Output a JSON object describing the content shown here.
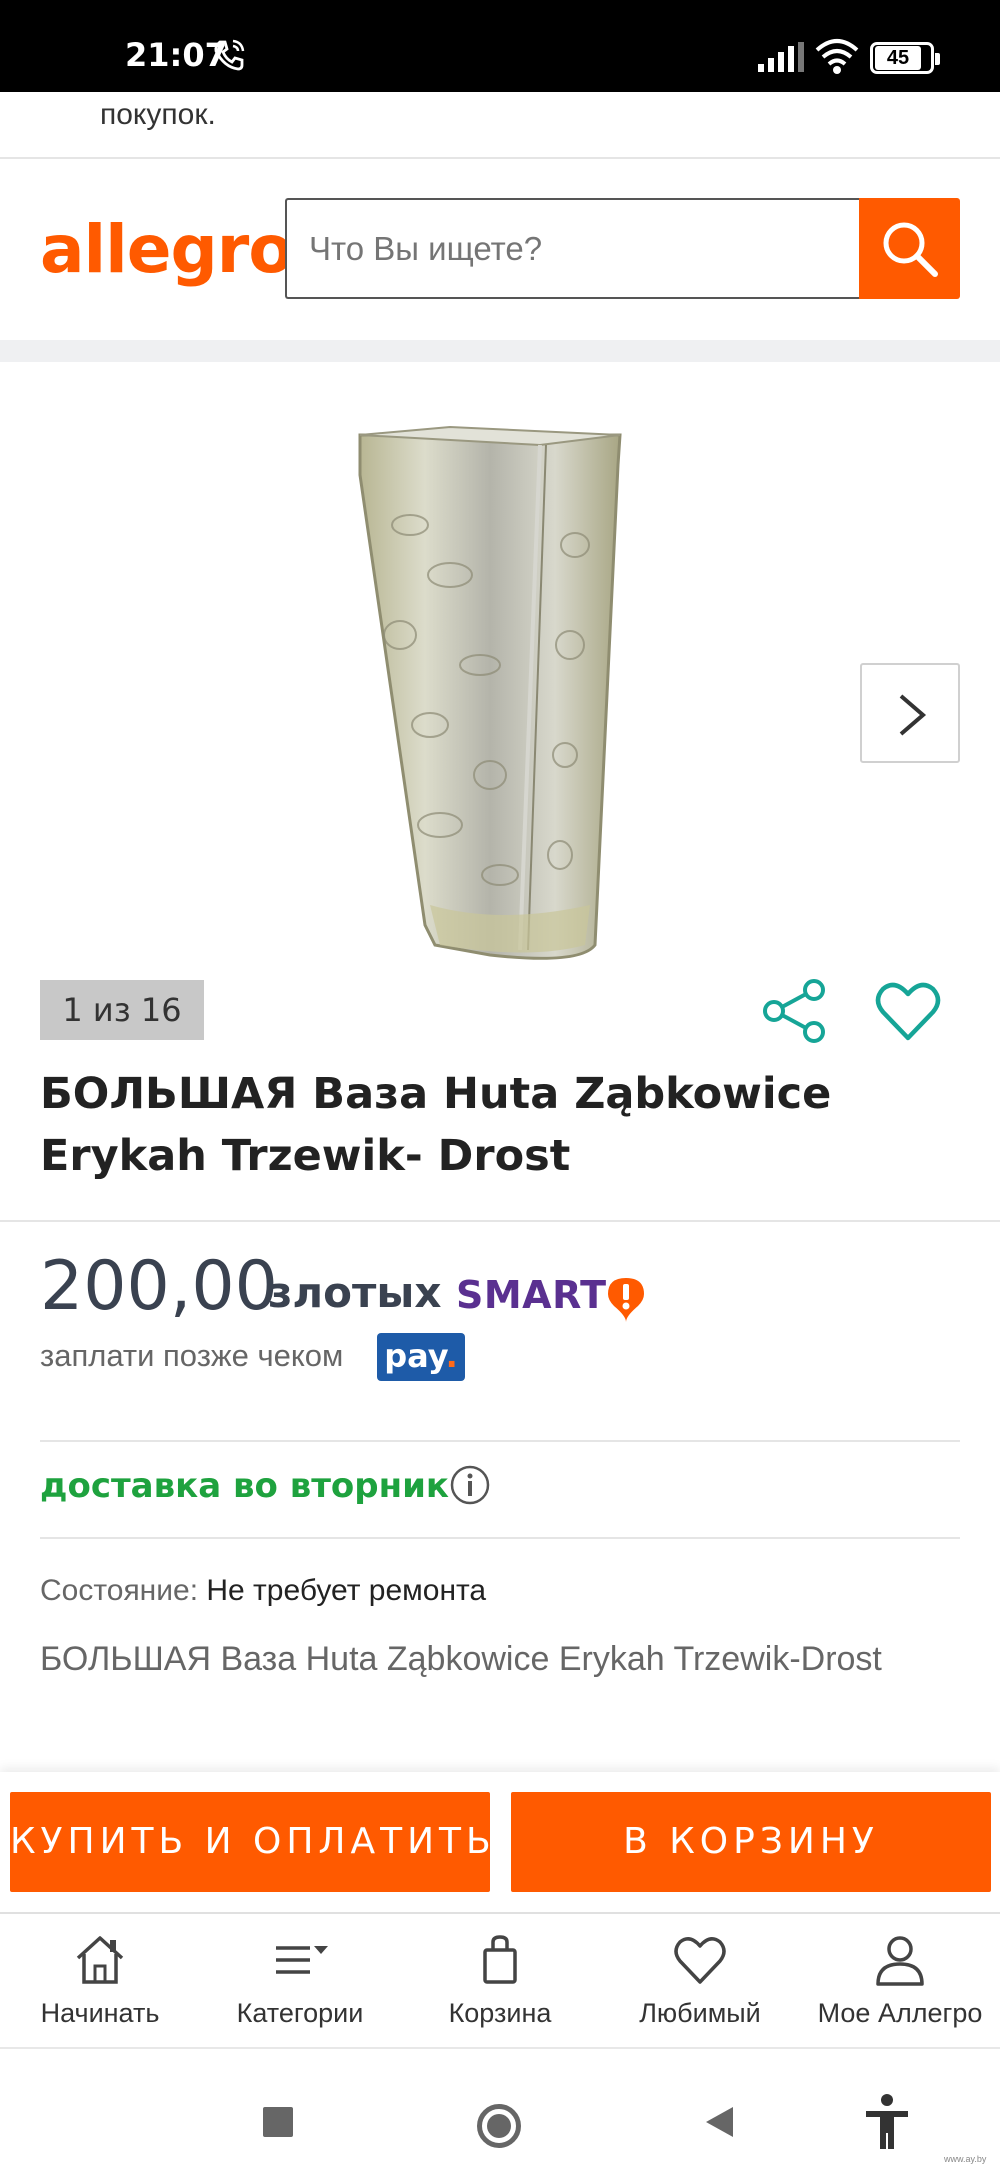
{
  "status_bar": {
    "time": "21:07",
    "battery": "45"
  },
  "top_info": "покупок.",
  "header": {
    "logo": "allegro",
    "search_placeholder": "Что Вы ищете?"
  },
  "gallery": {
    "counter": "1 из 16"
  },
  "product": {
    "title": "БОЛЬШАЯ Ваза Huta Ząbkowice Erykah Trzewik- Drost",
    "price": "200,00",
    "currency": "злотых",
    "smart": "SMART",
    "pay_later": "заплати позже чеком",
    "pay_badge_text": "pay",
    "pay_badge_dot": ".",
    "delivery": "доставка во вторник",
    "condition_label": "Состояние:",
    "condition_value": "Не требует ремонта",
    "description": "БОЛЬШАЯ Ваза Huta Ząbkowice Erykah Trzewik-Drost"
  },
  "actions": {
    "buy": "КУПИТЬ И ОПЛАТИТЬ",
    "cart": "В КОРЗИНУ"
  },
  "bottom_nav": [
    {
      "label": "Начинать",
      "icon": "home-icon"
    },
    {
      "label": "Категории",
      "icon": "menu-icon"
    },
    {
      "label": "Корзина",
      "icon": "bag-icon"
    },
    {
      "label": "Любимый",
      "icon": "heart-icon"
    },
    {
      "label": "Мое Аллегро",
      "icon": "user-icon"
    }
  ],
  "watermark": "www.ay.by",
  "colors": {
    "accent": "#ff5a00",
    "delivery": "#1ea23e",
    "smart": "#5a3090",
    "teal": "#16a597",
    "pay": "#1e5ba8"
  }
}
